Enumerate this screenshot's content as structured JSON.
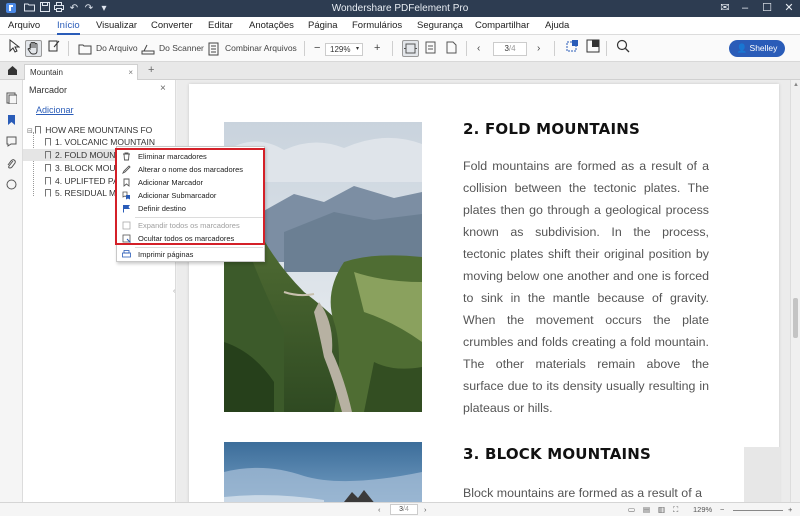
{
  "window": {
    "title": "Wondershare PDFelement Pro"
  },
  "menu": {
    "items": [
      "Arquivo",
      "Início",
      "Visualizar",
      "Converter",
      "Editar",
      "Anotações",
      "Página",
      "Formulários",
      "Segurança",
      "Compartilhar",
      "Ajuda"
    ],
    "active": "Início"
  },
  "toolbar": {
    "from_file": "Do Arquivo",
    "from_scanner": "Do Scanner",
    "combine_files": "Combinar Arquivos",
    "zoom_minus": "−",
    "zoom_value": "129%",
    "zoom_plus": "+",
    "page_current": "3",
    "page_total": "/4",
    "user_name": "Shelley"
  },
  "tabs": {
    "document_tab": "Mountain",
    "add_tab": "+"
  },
  "bookmark_panel": {
    "title": "Marcador",
    "add_link": "Adicionar",
    "root": "HOW ARE MOUNTAINS FO",
    "items": [
      "1. VOLCANIC MOUNTAIN",
      "2. FOLD MOUNTAIN",
      "3. BLOCK MOU",
      "4. UPLIFTED PA",
      "5. RESIDUAL M"
    ],
    "selected_index": 1
  },
  "context_menu": {
    "items": [
      {
        "label": "Eliminar marcadores",
        "icon": "trash-icon",
        "enabled": true
      },
      {
        "label": "Alterar o nome dos marcadores",
        "icon": "pencil-icon",
        "enabled": true
      },
      {
        "label": "Adicionar Marcador",
        "icon": "bookmark-add-icon",
        "enabled": true
      },
      {
        "label": "Adicionar Submarcador",
        "icon": "sub-bookmark-icon",
        "enabled": true
      },
      {
        "label": "Definir destino",
        "icon": "flag-icon",
        "enabled": true
      },
      {
        "label": "Expandir todos os marcadores",
        "icon": "expand-icon",
        "enabled": false
      },
      {
        "label": "Ocultar todos os marcadores",
        "icon": "collapse-icon",
        "enabled": true
      },
      {
        "label": "Imprimir páginas",
        "icon": "print-icon",
        "enabled": true
      }
    ],
    "highlight_color": "#d42028"
  },
  "document": {
    "section2_title": "2. FOLD MOUNTAINS",
    "section2_body": "Fold mountains are formed as a result of a collision between the tectonic plates. The plates then go through a geological process known as subdivision. In the process, tectonic plates shift their original position by moving below one another and one is forced to sink in the mantle because of gravity. When the movement occurs the plate crumbles and folds creating a fold mountain. The other materials remain above the surface due to its density usually resulting in plateaus or hills.",
    "section3_title": "3. BLOCK MOUNTAINS",
    "section3_body": "Block mountains are formed as a result of a"
  },
  "statusbar": {
    "page_current": "3",
    "page_total": "/4",
    "zoom_value": "129%"
  },
  "colors": {
    "titlebar": "#2d3c51",
    "accent": "#2a5cb8"
  }
}
